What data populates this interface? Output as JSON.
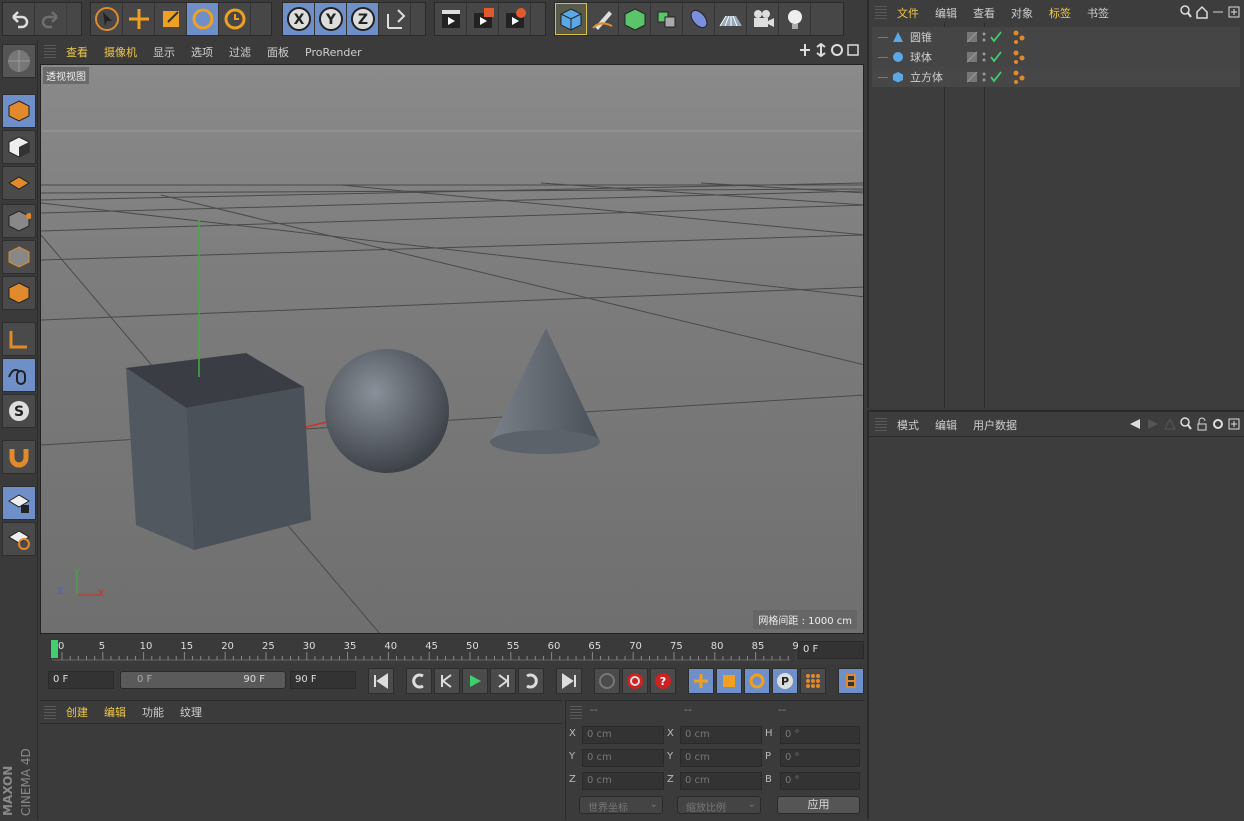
{
  "viewport": {
    "menu": [
      "查看",
      "摄像机",
      "显示",
      "选项",
      "过滤",
      "面板",
      "ProRender"
    ],
    "label": "透视视图",
    "grid_info": "网格间距 : 1000 cm"
  },
  "objects": {
    "menu": [
      "文件",
      "编辑",
      "查看",
      "对象",
      "标签",
      "书签"
    ],
    "items": [
      "圆锥",
      "球体",
      "立方体"
    ]
  },
  "attributes": {
    "menu": [
      "模式",
      "编辑",
      "用户数据"
    ]
  },
  "timeline": {
    "ticks": [
      "0",
      "5",
      "10",
      "15",
      "20",
      "25",
      "30",
      "35",
      "40",
      "45",
      "50",
      "55",
      "60",
      "65",
      "70",
      "75",
      "80",
      "85",
      "90"
    ],
    "current_frame": "0 F",
    "start_field": "0 F",
    "range_start": "0 F",
    "range_end": "90 F",
    "end_field": "90 F"
  },
  "materials": {
    "menu": [
      "创建",
      "编辑",
      "功能",
      "纹理"
    ]
  },
  "coords": {
    "headers": [
      "--",
      "--",
      "--"
    ],
    "rows": [
      {
        "a": "X",
        "av": "0 cm",
        "b": "X",
        "bv": "0 cm",
        "c": "H",
        "cv": "0 °"
      },
      {
        "a": "Y",
        "av": "0 cm",
        "b": "Y",
        "bv": "0 cm",
        "c": "P",
        "cv": "0 °"
      },
      {
        "a": "Z",
        "av": "0 cm",
        "b": "Z",
        "bv": "0 cm",
        "c": "B",
        "cv": "0 °"
      }
    ],
    "world": "世界坐标",
    "scale": "缩放比例",
    "apply": "应用"
  },
  "brand": {
    "maxon": "MAXON",
    "product": "CINEMA 4D"
  },
  "colors": {
    "accent": "#f0c84a",
    "highlight": "#6e8fc7",
    "orange": "#e08a2c"
  }
}
